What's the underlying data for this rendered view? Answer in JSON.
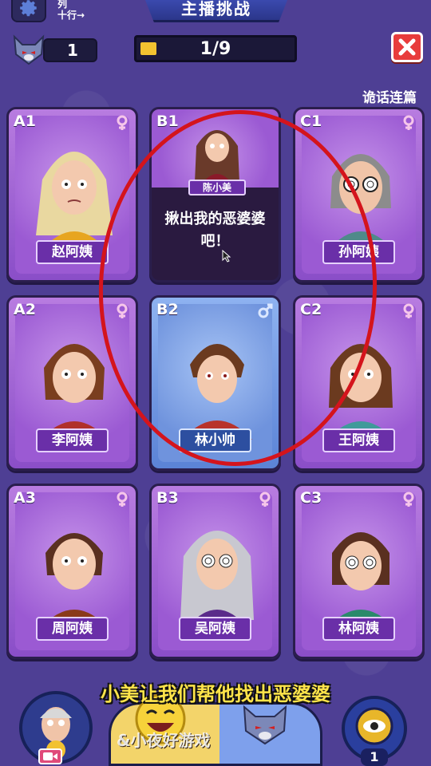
{
  "header": {
    "view_toggle_line1": "列",
    "view_toggle_line2": "十行→",
    "title": "主播挑战",
    "wolf_count": "1",
    "progress_text": "1/9",
    "progress_fraction": 0.11,
    "section_label": "诡话连篇"
  },
  "cards": [
    {
      "id": "A1",
      "name": "赵阿姨",
      "gender": "female",
      "style": "purple"
    },
    {
      "id": "B1",
      "speaker": "陈小美",
      "speech": "揪出我的恶婆婆吧！",
      "style": "dark"
    },
    {
      "id": "C1",
      "name": "孙阿姨",
      "gender": "female",
      "style": "purple"
    },
    {
      "id": "A2",
      "name": "李阿姨",
      "gender": "female",
      "style": "purple"
    },
    {
      "id": "B2",
      "name": "林小帅",
      "gender": "male",
      "style": "blue"
    },
    {
      "id": "C2",
      "name": "王阿姨",
      "gender": "female",
      "style": "purple"
    },
    {
      "id": "A3",
      "name": "周阿姨",
      "gender": "female",
      "style": "purple"
    },
    {
      "id": "B3",
      "name": "吴阿姨",
      "gender": "female",
      "style": "purple"
    },
    {
      "id": "C3",
      "name": "林阿姨",
      "gender": "female",
      "style": "purple"
    }
  ],
  "footer": {
    "subtitle": "小美让我们帮他找出恶婆婆",
    "watermark": "&小夜好游戏",
    "eye_count": "1"
  },
  "colors": {
    "background": "#4e3f94",
    "card_purple": "#9b5ad3",
    "card_blue": "#6f93dd",
    "highlight": "#d4141c",
    "subtitle": "#ffe44a"
  }
}
